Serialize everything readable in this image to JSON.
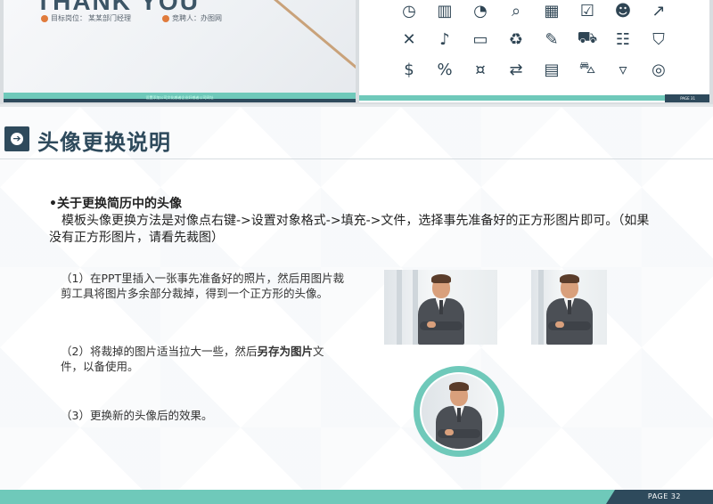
{
  "top_thumbnails": {
    "left": {
      "title": "THANK YOU",
      "target_label": "目标岗位：",
      "target_value": "某某部门经理",
      "applicant_label": "竞聘人：",
      "applicant_value": "办图网",
      "footnote": "设置添加公司文化感者企业好感者公司网址"
    },
    "right": {
      "icons": [
        "clock-icon",
        "books-icon",
        "pie-chart-icon",
        "magnifier-chart-icon",
        "calendar-icon",
        "checklist-icon",
        "worker-icon",
        "growth-chart-icon",
        "tools-icon",
        "microphone-icon",
        "monitor-icon",
        "recycle-icon",
        "wrench-icon",
        "truck-icon",
        "org-chart-icon",
        "shield-icon",
        "money-hand-icon",
        "percent-icon",
        "cash-icon",
        "exchange-icon",
        "cash-register-icon",
        "cart-icon",
        "basket-icon",
        "coins-icon"
      ],
      "page": "PAGE 31"
    }
  },
  "slide": {
    "title": "头像更换说明",
    "section_heading": "•关于更换简历中的头像",
    "section_body": "模板头像更换方法是对像点右键->设置对象格式->填充->文件，选择事先准备好的正方形图片即可。（如果没有正方形图片，请看先裁图）",
    "step1": "（1）在PPT里插入一张事先准备好的照片，然后用图片裁剪工具将图片多余部分裁掉，得到一个正方形的头像。",
    "step2_pre": "（2）将裁掉的图片适当拉大一些，然后",
    "step2_bold": "另存为图片",
    "step2_post": "文件，以备使用。",
    "step3": "（3）更换新的头像后的效果。",
    "page": "PAGE 32"
  },
  "colors": {
    "accent_teal": "#6fc9ba",
    "dark_navy": "#2e4a5c"
  }
}
